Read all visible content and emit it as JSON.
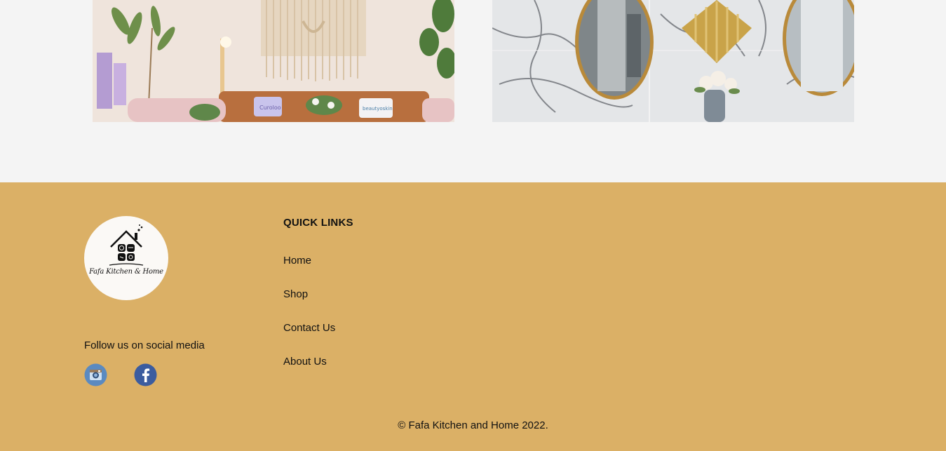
{
  "gallery": {
    "left_image": "living-room-photo",
    "right_image": "bathroom-mirrors-photo",
    "left_pillow_text": "Curoloo",
    "right_pillow_text": "beautyoskin"
  },
  "footer": {
    "logo_text": "Fafa Kitchen & Home",
    "follow_label": "Follow us on social media",
    "social": [
      {
        "name": "instagram-icon"
      },
      {
        "name": "facebook-icon"
      }
    ],
    "quick_links_title": "QUICK LINKS",
    "links": [
      {
        "label": "Home"
      },
      {
        "label": "Shop"
      },
      {
        "label": "Contact Us"
      },
      {
        "label": "About Us"
      }
    ],
    "copyright": "© Fafa Kitchen and Home 2022."
  },
  "colors": {
    "page_bg": "#f4f4f4",
    "footer_bg": "#dbb066",
    "text": "#111111",
    "instagram_blue": "#5b8ac0",
    "facebook_blue": "#3b5c9f"
  }
}
